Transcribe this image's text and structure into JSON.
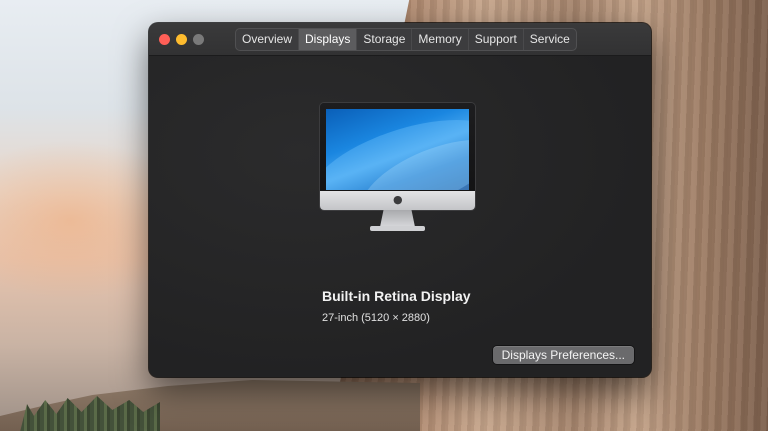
{
  "tabs": [
    {
      "label": "Overview"
    },
    {
      "label": "Displays"
    },
    {
      "label": "Storage"
    },
    {
      "label": "Memory"
    },
    {
      "label": "Support"
    },
    {
      "label": "Service"
    }
  ],
  "selected_tab": "Displays",
  "display": {
    "name": "Built-in Retina Display",
    "spec": "27-inch (5120 × 2880)"
  },
  "preferences_button": "Displays Preferences...",
  "icons": {
    "computer": "imac-icon",
    "logo": "apple-logo-icon"
  },
  "colors": {
    "close": "#ff5f57",
    "minimize": "#febc2e",
    "zoom_inactive": "#7a7a7a",
    "window_bg": "#262627"
  }
}
